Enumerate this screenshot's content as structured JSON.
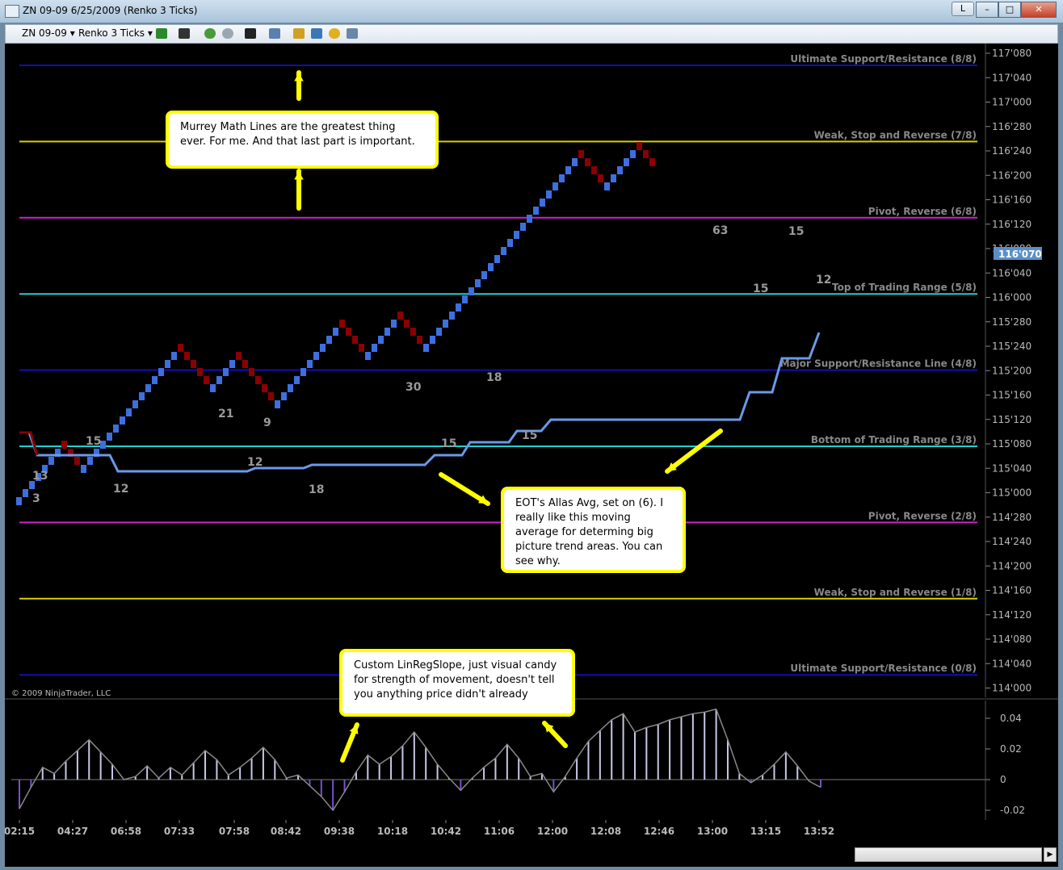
{
  "window": {
    "title": "ZN 09-09  6/25/2009 (Renko 3 Ticks)",
    "l_button": "L",
    "min_glyph": "–",
    "max_glyph": "□",
    "close_glyph": "✕"
  },
  "toolbar": {
    "instrument": "ZN 09-09",
    "period": "Renko 3 Ticks",
    "icons": [
      "candlestick-icon",
      "pencil-icon",
      "zoom-in-icon",
      "zoom-out-icon",
      "crosshair-icon",
      "properties-icon",
      "strategies-icon",
      "indicators-icon",
      "coin-icon",
      "data-box-icon"
    ]
  },
  "chart": {
    "copyright": "© 2009 NinjaTrader, LLC",
    "current_price": "116'070",
    "price_ticks": [
      "117'080",
      "117'040",
      "117'000",
      "116'280",
      "116'240",
      "116'200",
      "116'160",
      "116'120",
      "116'080",
      "116'040",
      "116'000",
      "115'280",
      "115'240",
      "115'200",
      "115'160",
      "115'120",
      "115'080",
      "115'040",
      "115'000",
      "114'280",
      "114'240",
      "114'200",
      "114'160",
      "114'120",
      "114'080",
      "114'040",
      "114'000"
    ],
    "murrey_lines": [
      {
        "label": "Ultimate Support/Resistance (8/8)",
        "color": "#1010b0"
      },
      {
        "label": "Weak, Stop and Reverse (7/8)",
        "color": "#d8d000"
      },
      {
        "label": "Pivot, Reverse (6/8)",
        "color": "#d020d0"
      },
      {
        "label": "Top of Trading Range (5/8)",
        "color": "#20d0d0"
      },
      {
        "label": "Major Support/Resistance Line (4/8)",
        "color": "#1010b0"
      },
      {
        "label": "Bottom of Trading Range (3/8)",
        "color": "#20d0d0"
      },
      {
        "label": "Pivot, Reverse (2/8)",
        "color": "#d020d0"
      },
      {
        "label": "Weak, Stop and Reverse (1/8)",
        "color": "#d8d000"
      },
      {
        "label": "Ultimate Support/Resistance (0/8)",
        "color": "#1010b0"
      }
    ],
    "swing_labels": [
      "13",
      "3",
      "15",
      "12",
      "21",
      "12",
      "9",
      "18",
      "30",
      "15",
      "18",
      "15",
      "63",
      "15",
      "15",
      "12"
    ],
    "indicator_ticks": [
      "0.04",
      "0.02",
      "0",
      "-0.02"
    ],
    "time_ticks": [
      "02:15",
      "04:27",
      "06:58",
      "07:33",
      "07:58",
      "08:42",
      "09:38",
      "10:18",
      "10:42",
      "11:06",
      "12:00",
      "12:08",
      "12:46",
      "13:00",
      "13:15",
      "13:52"
    ]
  },
  "callouts": {
    "murrey": "Murrey Math Lines are the greatest thing ever. For me.  And that last part is important.",
    "eot": "EOT's Allas Avg, set on (6).  I really like this moving average for determing big picture trend areas.  You can see why.",
    "linreg": "Custom LinRegSlope, just visual candy for strength of movement, doesn't tell you anything price didn't already"
  },
  "colors": {
    "up_brick": "#3d6fe0",
    "down_brick": "#8b0000",
    "moving_average": "#6a9ae8",
    "callout_border": "#ffff00"
  }
}
